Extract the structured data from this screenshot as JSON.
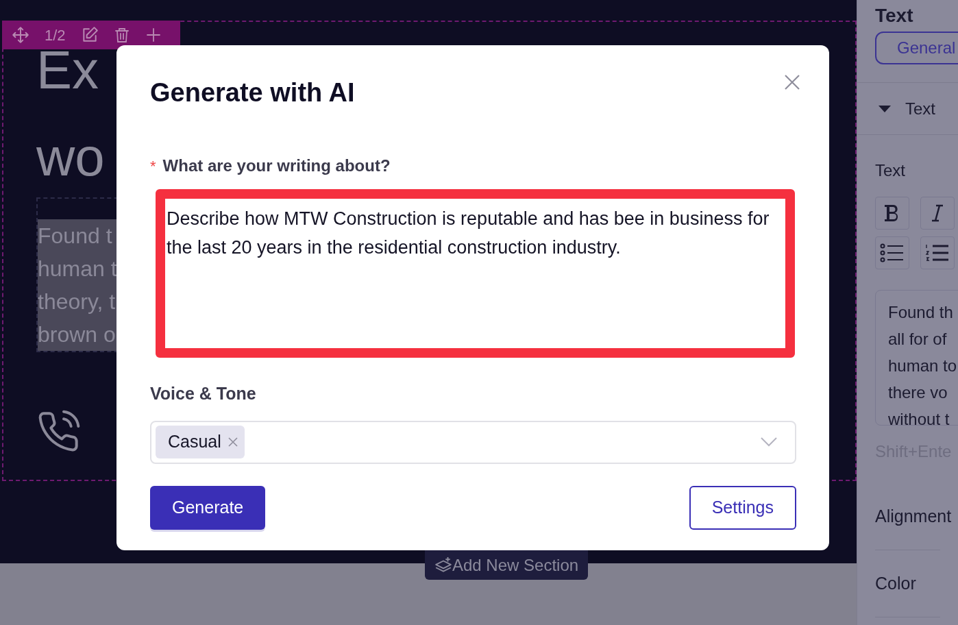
{
  "editor": {
    "toolbar": {
      "counter": "1/2"
    },
    "heading_lines": [
      "Ex",
      "wo"
    ],
    "paragraph_lines": [
      "Found t",
      "human t",
      "theory, t",
      "brown o"
    ],
    "add_section": "Add New Section"
  },
  "panel": {
    "title": "Text",
    "tab": "General",
    "section": {
      "label": "Text",
      "expanded": true
    },
    "field_label": "Text",
    "textarea_lines": [
      "Found th",
      "all for of",
      "human to",
      "there vo",
      "without t"
    ],
    "hint": "Shift+Ente",
    "rows": [
      "Alignment",
      "Color"
    ]
  },
  "modal": {
    "title": "Generate with AI",
    "prompt": {
      "required_mark": "*",
      "label": "What are your writing about?",
      "value": "Describe how MTW Construction is reputable and has bee in business for the last 20 years in the residential construction industry.",
      "highlighted": true
    },
    "voice": {
      "label": "Voice & Tone",
      "tags": [
        "Casual"
      ]
    },
    "buttons": [
      {
        "label": "Generate",
        "kind": "primary"
      },
      {
        "label": "Settings",
        "kind": "secondary"
      }
    ]
  }
}
